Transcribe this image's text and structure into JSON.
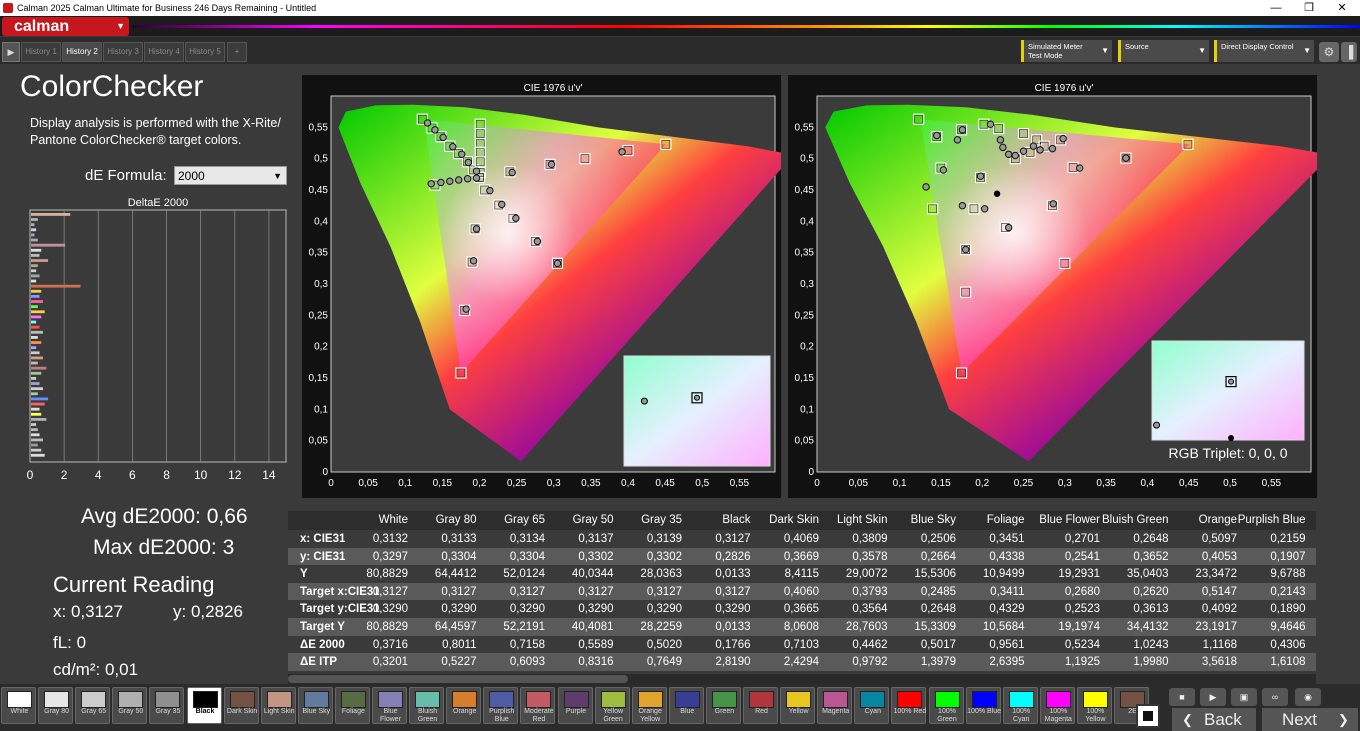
{
  "window": {
    "title": "Calman 2025 Calman Ultimate for Business 246 Days Remaining  - Untitled",
    "controls": [
      "—",
      "❐",
      "✕"
    ]
  },
  "app": {
    "logo": "calman"
  },
  "history_tabs": [
    "History 1",
    "History 2",
    "History 3",
    "History 4",
    "History 5",
    "+"
  ],
  "active_tab": 1,
  "dropdowns": [
    {
      "label": "Simulated Meter",
      "sub": "Test Mode"
    },
    {
      "label": "Source",
      "sub": ""
    },
    {
      "label": "Direct Display Control",
      "sub": ""
    }
  ],
  "left": {
    "title": "ColorChecker",
    "description": "Display analysis is performed with the X-Rite/ Pantone ColorChecker® target colors.",
    "formula_label": "dE Formula:",
    "formula_value": "2000"
  },
  "de_chart": {
    "title": "DeltaE 2000",
    "xticks": [
      "0",
      "2",
      "4",
      "6",
      "8",
      "10",
      "12",
      "14"
    ],
    "xmax": 15,
    "bars": [
      {
        "v": 2.3,
        "c": "#d8b0a0"
      },
      {
        "v": 0.4,
        "c": "#b0b0b0"
      },
      {
        "v": 0.2,
        "c": "#b0b0b0"
      },
      {
        "v": 0.3,
        "c": "#d0d0d0"
      },
      {
        "v": 0.2,
        "c": "#9ac"
      },
      {
        "v": 0.4,
        "c": "#aaa"
      },
      {
        "v": 2.0,
        "c": "#c090a0"
      },
      {
        "v": 0.6,
        "c": "#ddd"
      },
      {
        "v": 0.5,
        "c": "#bbb"
      },
      {
        "v": 1.0,
        "c": "#cc9988"
      },
      {
        "v": 0.4,
        "c": "#aa8"
      },
      {
        "v": 0.3,
        "c": "#ccc"
      },
      {
        "v": 0.5,
        "c": "#9aa"
      },
      {
        "v": 0.3,
        "c": "#ddd"
      },
      {
        "v": 2.9,
        "c": "#d07050"
      },
      {
        "v": 0.6,
        "c": "#e8d050"
      },
      {
        "v": 0.5,
        "c": "#9090ff"
      },
      {
        "v": 0.7,
        "c": "#ff60a0"
      },
      {
        "v": 0.4,
        "c": "#60ff60"
      },
      {
        "v": 0.8,
        "c": "#ffd040"
      },
      {
        "v": 0.6,
        "c": "#ff70ff"
      },
      {
        "v": 0.3,
        "c": "#70ffff"
      },
      {
        "v": 0.5,
        "c": "#ff5050"
      },
      {
        "v": 0.7,
        "c": "#bbb"
      },
      {
        "v": 0.4,
        "c": "#ddd"
      },
      {
        "v": 0.6,
        "c": "#ff9040"
      },
      {
        "v": 0.3,
        "c": "#9af"
      },
      {
        "v": 0.5,
        "c": "#ccc"
      },
      {
        "v": 0.7,
        "c": "#d0a080"
      },
      {
        "v": 0.4,
        "c": "#bbb"
      },
      {
        "v": 0.9,
        "c": "#c08080"
      },
      {
        "v": 0.6,
        "c": "#9c9"
      },
      {
        "v": 0.3,
        "c": "#ccc"
      },
      {
        "v": 0.5,
        "c": "#a0a0d0"
      },
      {
        "v": 0.7,
        "c": "#d0d0d0"
      },
      {
        "v": 0.4,
        "c": "#a0d0a0"
      },
      {
        "v": 1.0,
        "c": "#6090ff"
      },
      {
        "v": 0.8,
        "c": "#ff6060"
      },
      {
        "v": 0.5,
        "c": "#ddd"
      },
      {
        "v": 0.6,
        "c": "#ffff60"
      },
      {
        "v": 0.9,
        "c": "#b0b0b0"
      },
      {
        "v": 0.3,
        "c": "#ccc"
      },
      {
        "v": 0.4,
        "c": "#bbb"
      },
      {
        "v": 0.5,
        "c": "#ddd"
      },
      {
        "v": 0.7,
        "c": "#bbb"
      },
      {
        "v": 0.4,
        "c": "#999"
      },
      {
        "v": 0.6,
        "c": "#ccc"
      },
      {
        "v": 0.8,
        "c": "#ddd"
      }
    ]
  },
  "stats": {
    "avg": "Avg dE2000: 0,66",
    "max": "Max dE2000: 3",
    "current_label": "Current Reading",
    "x": "x: 0,3127",
    "y": "y: 0,2826",
    "fl": "fL: 0",
    "cdm2": "cd/m²: 0,01"
  },
  "chart_data": [
    {
      "type": "scatter",
      "title": "CIE 1976 u'v'",
      "xlim": [
        0,
        0.6
      ],
      "ylim": [
        0,
        0.6
      ],
      "xticks": [
        "0",
        "0,05",
        "0,1",
        "0,15",
        "0,2",
        "0,25",
        "0,3",
        "0,35",
        "0,4",
        "0,45",
        "0,5",
        "0,55"
      ],
      "yticks": [
        "0",
        "0,05",
        "0,1",
        "0,15",
        "0,2",
        "0,25",
        "0,3",
        "0,35",
        "0,4",
        "0,45",
        "0,5",
        "0,55"
      ],
      "targets": [
        [
          0.123,
          0.563
        ],
        [
          0.136,
          0.549
        ],
        [
          0.148,
          0.535
        ],
        [
          0.16,
          0.52
        ],
        [
          0.172,
          0.508
        ],
        [
          0.184,
          0.495
        ],
        [
          0.192,
          0.482
        ],
        [
          0.2,
          0.47
        ],
        [
          0.201,
          0.555
        ],
        [
          0.201,
          0.54
        ],
        [
          0.201,
          0.524
        ],
        [
          0.201,
          0.51
        ],
        [
          0.201,
          0.495
        ],
        [
          0.201,
          0.478
        ],
        [
          0.14,
          0.458
        ],
        [
          0.2,
          0.47
        ],
        [
          0.207,
          0.45
        ],
        [
          0.226,
          0.426
        ],
        [
          0.245,
          0.405
        ],
        [
          0.275,
          0.368
        ],
        [
          0.305,
          0.333
        ],
        [
          0.19,
          0.335
        ],
        [
          0.18,
          0.258
        ],
        [
          0.175,
          0.158
        ],
        [
          0.194,
          0.388
        ],
        [
          0.241,
          0.479
        ],
        [
          0.295,
          0.491
        ],
        [
          0.342,
          0.5
        ],
        [
          0.4,
          0.513
        ],
        [
          0.451,
          0.523
        ]
      ],
      "measured": [
        [
          0.13,
          0.557
        ],
        [
          0.14,
          0.546
        ],
        [
          0.151,
          0.534
        ],
        [
          0.164,
          0.519
        ],
        [
          0.176,
          0.507
        ],
        [
          0.185,
          0.494
        ],
        [
          0.196,
          0.48
        ],
        [
          0.196,
          0.469
        ],
        [
          0.135,
          0.46
        ],
        [
          0.148,
          0.462
        ],
        [
          0.16,
          0.464
        ],
        [
          0.172,
          0.466
        ],
        [
          0.184,
          0.468
        ],
        [
          0.214,
          0.449
        ],
        [
          0.23,
          0.427
        ],
        [
          0.249,
          0.405
        ],
        [
          0.278,
          0.368
        ],
        [
          0.305,
          0.333
        ],
        [
          0.192,
          0.337
        ],
        [
          0.182,
          0.26
        ],
        [
          0.196,
          0.388
        ],
        [
          0.244,
          0.478
        ],
        [
          0.297,
          0.491
        ],
        [
          0.392,
          0.511
        ]
      ],
      "inset_target": [
        0.5,
        0.38
      ],
      "inset_measured": [
        0.14,
        0.41
      ],
      "inset_label": ""
    },
    {
      "type": "scatter",
      "title": "CIE 1976 u'v'",
      "xlim": [
        0,
        0.6
      ],
      "ylim": [
        0,
        0.6
      ],
      "xticks": [
        "0",
        "0,05",
        "0,1",
        "0,15",
        "0,2",
        "0,25",
        "0,3",
        "0,35",
        "0,4",
        "0,45",
        "0,5",
        "0,55"
      ],
      "yticks": [
        "0",
        "0,05",
        "0,1",
        "0,15",
        "0,2",
        "0,25",
        "0,3",
        "0,35",
        "0,4",
        "0,45",
        "0,5",
        "0,55"
      ],
      "targets": [
        [
          0.123,
          0.563
        ],
        [
          0.145,
          0.535
        ],
        [
          0.175,
          0.546
        ],
        [
          0.202,
          0.555
        ],
        [
          0.22,
          0.548
        ],
        [
          0.25,
          0.54
        ],
        [
          0.266,
          0.53
        ],
        [
          0.295,
          0.53
        ],
        [
          0.198,
          0.47
        ],
        [
          0.19,
          0.42
        ],
        [
          0.18,
          0.355
        ],
        [
          0.18,
          0.287
        ],
        [
          0.175,
          0.158
        ],
        [
          0.14,
          0.42
        ],
        [
          0.15,
          0.485
        ],
        [
          0.228,
          0.39
        ],
        [
          0.285,
          0.425
        ],
        [
          0.3,
          0.333
        ],
        [
          0.31,
          0.486
        ],
        [
          0.374,
          0.501
        ],
        [
          0.449,
          0.523
        ],
        [
          0.24,
          0.5
        ],
        [
          0.258,
          0.51
        ],
        [
          0.275,
          0.52
        ]
      ],
      "measured": [
        [
          0.145,
          0.537
        ],
        [
          0.17,
          0.53
        ],
        [
          0.176,
          0.546
        ],
        [
          0.21,
          0.555
        ],
        [
          0.222,
          0.53
        ],
        [
          0.225,
          0.518
        ],
        [
          0.232,
          0.507
        ],
        [
          0.24,
          0.505
        ],
        [
          0.25,
          0.512
        ],
        [
          0.262,
          0.52
        ],
        [
          0.27,
          0.514
        ],
        [
          0.285,
          0.516
        ],
        [
          0.298,
          0.532
        ],
        [
          0.198,
          0.472
        ],
        [
          0.176,
          0.425
        ],
        [
          0.132,
          0.455
        ],
        [
          0.153,
          0.482
        ],
        [
          0.232,
          0.39
        ],
        [
          0.286,
          0.428
        ],
        [
          0.318,
          0.485
        ],
        [
          0.374,
          0.501
        ],
        [
          0.203,
          0.42
        ],
        [
          0.18,
          0.355
        ]
      ],
      "black_points": [
        [
          0.218,
          0.444
        ]
      ],
      "inset_target": [
        0.52,
        0.41
      ],
      "inset_measured": [
        0.03,
        0.85
      ],
      "inset_black": [
        0.52,
        0.02
      ],
      "inset_label": "RGB Triplet: 0, 0, 0"
    }
  ],
  "table": {
    "columns": [
      "White",
      "Gray 80",
      "Gray 65",
      "Gray 50",
      "Gray 35",
      "Black",
      "Dark Skin",
      "Light Skin",
      "Blue Sky",
      "Foliage",
      "Blue Flower",
      "Bluish Green",
      "Orange",
      "Purplish Blue"
    ],
    "rows": [
      {
        "label": "x: CIE31",
        "values": [
          "0,3132",
          "0,3133",
          "0,3134",
          "0,3137",
          "0,3139",
          "0,3127",
          "0,4069",
          "0,3809",
          "0,2506",
          "0,3451",
          "0,2701",
          "0,2648",
          "0,5097",
          "0,2159"
        ]
      },
      {
        "label": "y: CIE31",
        "values": [
          "0,3297",
          "0,3304",
          "0,3304",
          "0,3302",
          "0,3302",
          "0,2826",
          "0,3669",
          "0,3578",
          "0,2664",
          "0,4338",
          "0,2541",
          "0,3652",
          "0,4053",
          "0,1907"
        ]
      },
      {
        "label": "Y",
        "values": [
          "80,8829",
          "64,4412",
          "52,0124",
          "40,0344",
          "28,0363",
          "0,0133",
          "8,4115",
          "29,0072",
          "15,5306",
          "10,9499",
          "19,2931",
          "35,0403",
          "23,3472",
          "9,6788"
        ]
      },
      {
        "label": "Target x:CIE31",
        "values": [
          "0,3127",
          "0,3127",
          "0,3127",
          "0,3127",
          "0,3127",
          "0,3127",
          "0,4060",
          "0,3793",
          "0,2485",
          "0,3411",
          "0,2680",
          "0,2620",
          "0,5147",
          "0,2143"
        ]
      },
      {
        "label": "Target y:CIE31",
        "values": [
          "0,3290",
          "0,3290",
          "0,3290",
          "0,3290",
          "0,3290",
          "0,3290",
          "0,3665",
          "0,3564",
          "0,2648",
          "0,4329",
          "0,2523",
          "0,3613",
          "0,4092",
          "0,1890"
        ]
      },
      {
        "label": "Target Y",
        "values": [
          "80,8829",
          "64,4597",
          "52,2191",
          "40,4081",
          "28,2259",
          "0,0133",
          "8,0608",
          "28,7603",
          "15,3309",
          "10,5684",
          "19,1974",
          "34,4132",
          "23,1917",
          "9,4646"
        ]
      },
      {
        "label": "ΔE 2000",
        "values": [
          "0,3716",
          "0,8011",
          "0,7158",
          "0,5589",
          "0,5020",
          "0,1766",
          "0,7103",
          "0,4462",
          "0,5017",
          "0,9561",
          "0,5234",
          "1,0243",
          "1,1168",
          "0,4306"
        ]
      },
      {
        "label": "ΔE ITP",
        "values": [
          "0,3201",
          "0,5227",
          "0,6093",
          "0,8316",
          "0,7649",
          "2,8190",
          "2,4294",
          "0,9792",
          "1,3979",
          "2,6395",
          "1,1925",
          "1,9980",
          "3,5618",
          "1,6108"
        ]
      }
    ]
  },
  "swatches": [
    {
      "name": "White",
      "color": "#ffffff"
    },
    {
      "name": "Gray 80",
      "color": "#e6e6e6"
    },
    {
      "name": "Gray 65",
      "color": "#cccccc"
    },
    {
      "name": "Gray 50",
      "color": "#b0b0b0"
    },
    {
      "name": "Gray 35",
      "color": "#8f8f8f"
    },
    {
      "name": "Black",
      "color": "#000000"
    },
    {
      "name": "Dark Skin",
      "color": "#735244"
    },
    {
      "name": "Light Skin",
      "color": "#c29682"
    },
    {
      "name": "Blue Sky",
      "color": "#627a9d"
    },
    {
      "name": "Foliage",
      "color": "#576c43"
    },
    {
      "name": "Blue Flower",
      "color": "#8580b1"
    },
    {
      "name": "Bluish Green",
      "color": "#67bdaa"
    },
    {
      "name": "Orange",
      "color": "#d67e2c"
    },
    {
      "name": "Purplish Blue",
      "color": "#505ba6"
    },
    {
      "name": "Moderate Red",
      "color": "#c15a63"
    },
    {
      "name": "Purple",
      "color": "#5e3c6c"
    },
    {
      "name": "Yellow Green",
      "color": "#9dbc40"
    },
    {
      "name": "Orange Yellow",
      "color": "#e0a32e"
    },
    {
      "name": "Blue",
      "color": "#383d96"
    },
    {
      "name": "Green",
      "color": "#469449"
    },
    {
      "name": "Red",
      "color": "#af363c"
    },
    {
      "name": "Yellow",
      "color": "#e7c71f"
    },
    {
      "name": "Magenta",
      "color": "#bb5695"
    },
    {
      "name": "Cyan",
      "color": "#0885a1"
    },
    {
      "name": "100% Red",
      "color": "#ff0000"
    },
    {
      "name": "100% Green",
      "color": "#00ff00"
    },
    {
      "name": "100% Blue",
      "color": "#0000ff"
    },
    {
      "name": "100% Cyan",
      "color": "#00ffff"
    },
    {
      "name": "100% Magenta",
      "color": "#ff00ff"
    },
    {
      "name": "100% Yellow",
      "color": "#ffff00"
    },
    {
      "name": "2E",
      "color": "#735244"
    }
  ],
  "selected_swatch": 5,
  "controls": {
    "back": "Back",
    "next": "Next"
  }
}
